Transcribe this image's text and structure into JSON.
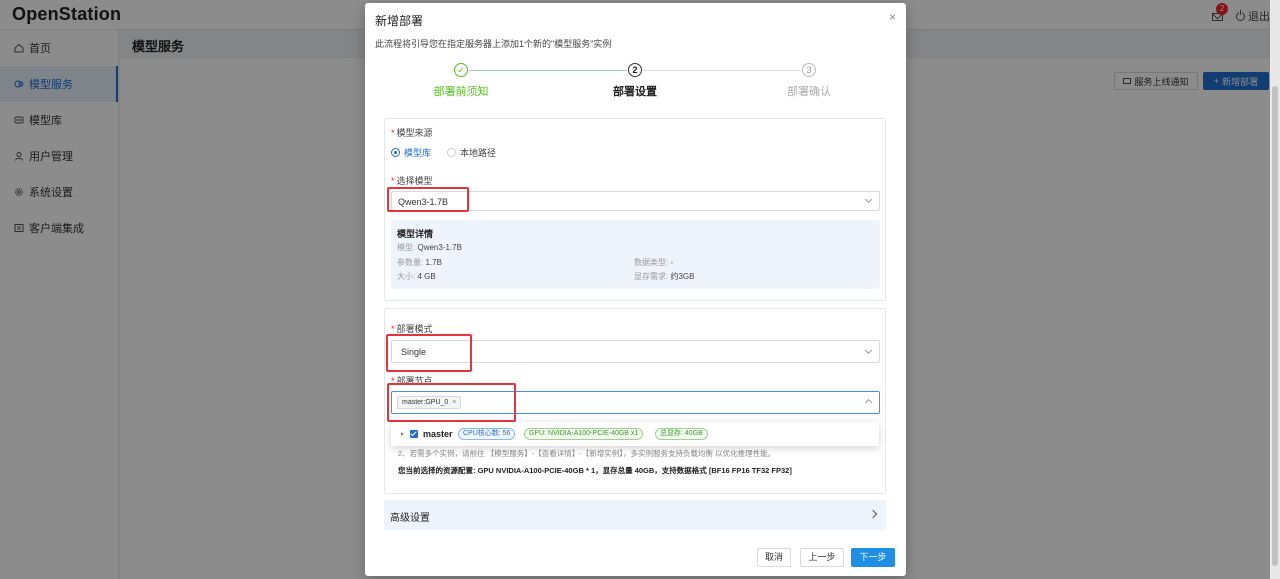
{
  "app": {
    "brand": "OpenStation",
    "logout_label": "退出",
    "notification_count": "2"
  },
  "sidebar": {
    "items": [
      {
        "label": "首页",
        "icon": "home-icon",
        "active": false
      },
      {
        "label": "模型服务",
        "icon": "model-service-icon",
        "active": true
      },
      {
        "label": "模型库",
        "icon": "model-library-icon",
        "active": false
      },
      {
        "label": "用户管理",
        "icon": "user-icon",
        "active": false
      },
      {
        "label": "系统设置",
        "icon": "gear-icon",
        "active": false
      },
      {
        "label": "客户端集成",
        "icon": "client-icon",
        "active": false
      }
    ]
  },
  "main": {
    "title": "模型服务",
    "notify_button": "服务上线通知",
    "new_button": "新增部署"
  },
  "modal": {
    "title": "新增部署",
    "close": "×",
    "description": "此流程将引导您在指定服务器上添加1个新的\"模型服务\"实例",
    "steps": [
      {
        "number": "✓",
        "label": "部署前须知",
        "state": "done"
      },
      {
        "number": "2",
        "label": "部署设置",
        "state": "current"
      },
      {
        "number": "3",
        "label": "部署确认",
        "state": "pending"
      }
    ],
    "source": {
      "label": "模型来源",
      "options": [
        {
          "label": "模型库",
          "checked": true
        },
        {
          "label": "本地路径",
          "checked": false
        }
      ]
    },
    "model_select": {
      "label": "选择模型",
      "value": "Qwen3-1.7B"
    },
    "model_detail": {
      "title": "模型详情",
      "model_key": "模型:",
      "model_val": "Qwen3-1.7B",
      "params_key": "参数量:",
      "params_val": "1.7B",
      "dtype_key": "数据类型:",
      "dtype_val": "-",
      "size_key": "大小:",
      "size_val": "4 GB",
      "vram_key": "显存需求:",
      "vram_val": "约3GB"
    },
    "deploy_mode": {
      "label": "部署模式",
      "value": "Single"
    },
    "deploy_node": {
      "label": "部署节点",
      "selected_tag": "master:GPU_0",
      "tree": {
        "node_name": "master",
        "cpu": "CPU核心数: 56",
        "gpu": "GPU: NVIDIA-A100-PCIE-40GB x1",
        "vram": "总显存: 40GB"
      }
    },
    "hint_line": "2、若需多个实例，请前往 【模型服务】-【查看详情】-【新增实例】，多实例服务支持负载均衡 以优化推理性能。",
    "resource_summary": "您当前选择的资源配置: GPU NVIDIA-A100-PCIE-40GB * 1，显存总量 40GB，支持数据格式 [BF16 FP16 TF32 FP32]",
    "advanced": "高级设置",
    "buttons": {
      "cancel": "取消",
      "prev": "上一步",
      "next": "下一步"
    }
  },
  "colors": {
    "accent": "#1f6fd1",
    "success": "#52c41a",
    "highlight": "#e5343d"
  }
}
